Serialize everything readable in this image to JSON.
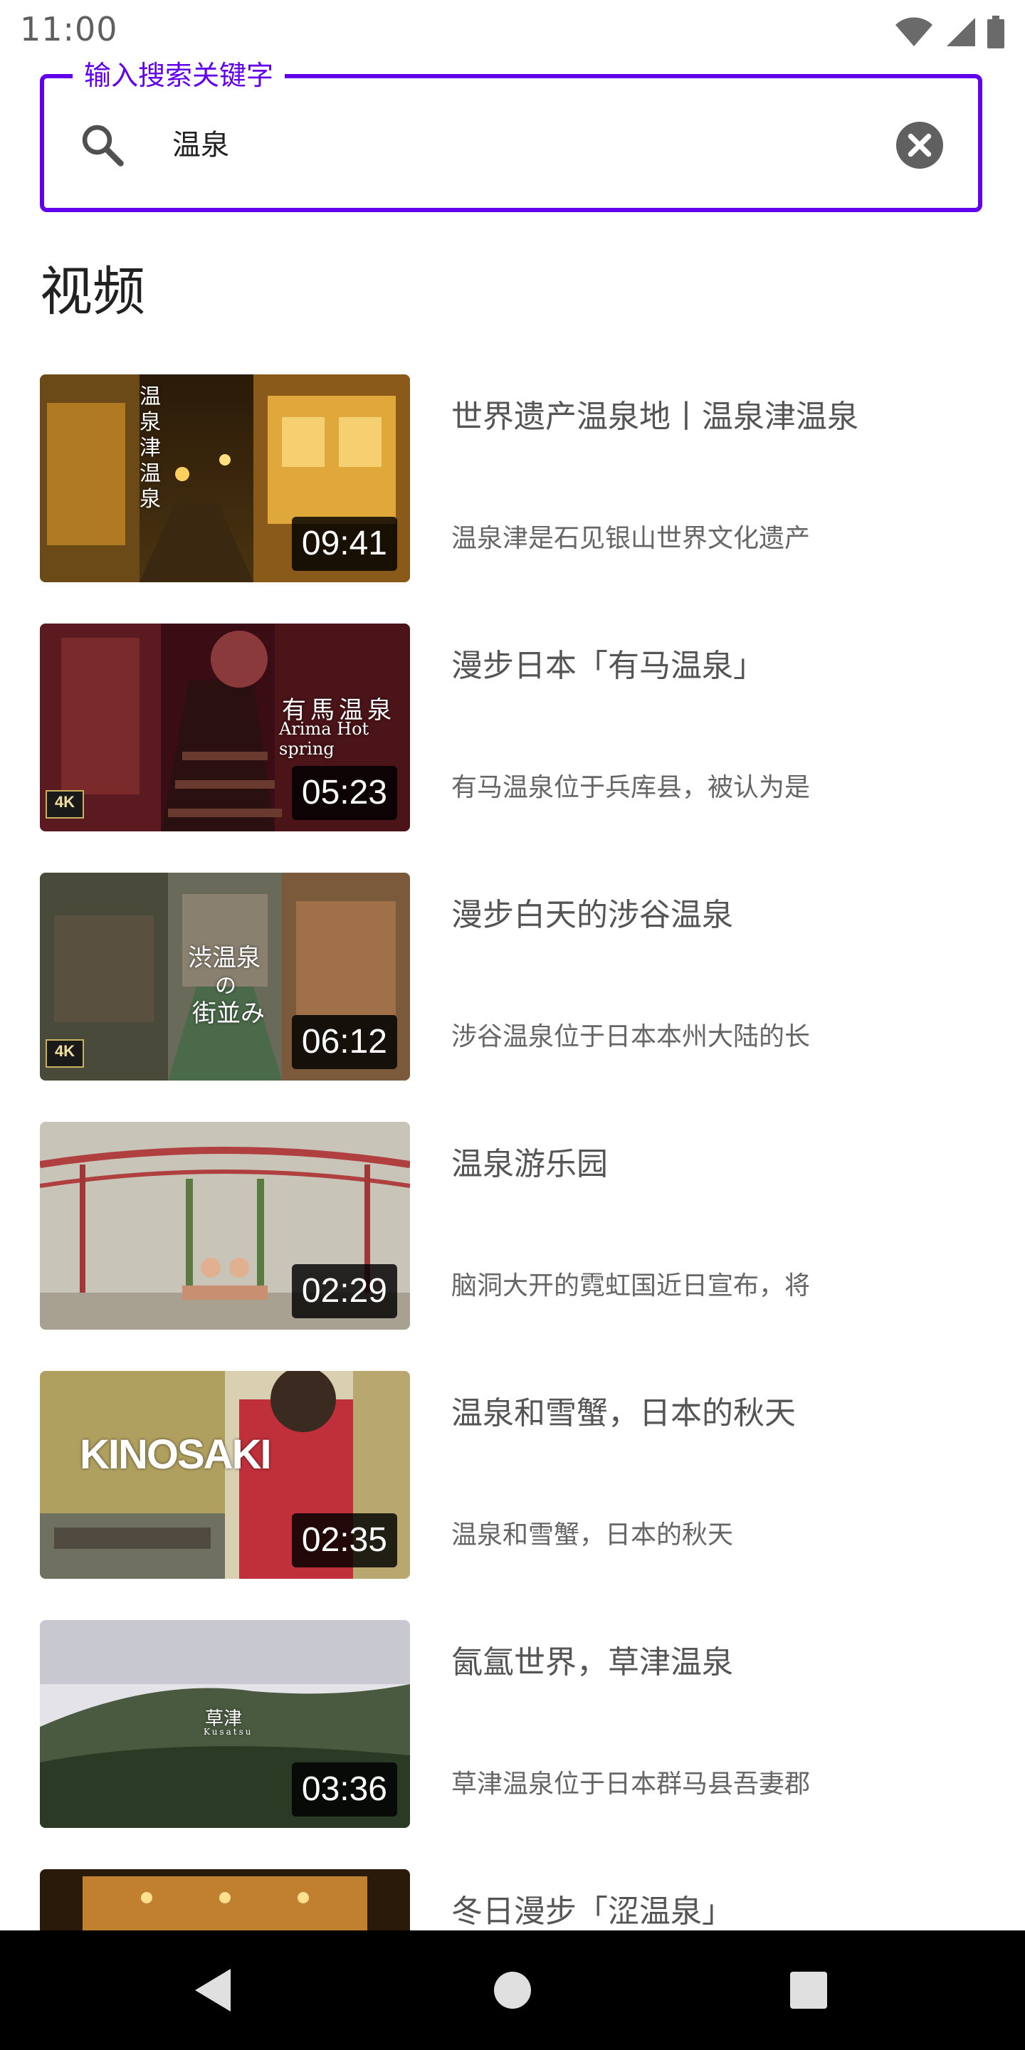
{
  "status_bar": {
    "time": "11:00",
    "icons": [
      "wifi-icon",
      "signal-icon",
      "battery-icon"
    ]
  },
  "search": {
    "label": "输入搜索关键字",
    "value": "温泉",
    "accent_color": "#6200ee"
  },
  "section": {
    "title": "视频"
  },
  "videos": [
    {
      "title": "世界遗产温泉地丨温泉津温泉",
      "description": "温泉津是石见银山世界文化遗产",
      "duration": "09:41",
      "badge": "",
      "thumb_caption": "温泉津温泉"
    },
    {
      "title": "漫步日本「有马温泉」",
      "description": "有马温泉位于兵库县，被认为是",
      "duration": "05:23",
      "badge": "4K",
      "thumb_caption": "有馬温泉",
      "thumb_subcaption": "Arima Hot spring"
    },
    {
      "title": "漫步白天的涉谷温泉",
      "description": "涉谷温泉位于日本本州大陆的长",
      "duration": "06:12",
      "badge": "4K",
      "thumb_caption": "渋温泉",
      "thumb_subcaption": "の",
      "thumb_subcaption2": "街並み"
    },
    {
      "title": "温泉游乐园",
      "description": "脑洞大开的霓虹国近日宣布，将",
      "duration": "02:29",
      "badge": ""
    },
    {
      "title": "温泉和雪蟹，日本的秋天",
      "description": "温泉和雪蟹，日本的秋天",
      "duration": "02:35",
      "badge": "",
      "thumb_caption": "KINOSAKI"
    },
    {
      "title": "氤氲世界，草津温泉",
      "description": "草津温泉位于日本群马县吾妻郡",
      "duration": "03:36",
      "badge": "",
      "thumb_caption": "草津",
      "thumb_subcaption": "Kusatsu"
    },
    {
      "title": "冬日漫步「涩温泉」",
      "description": "",
      "duration": "",
      "badge": ""
    }
  ],
  "nav_bar": {
    "buttons": [
      "back-icon",
      "home-icon",
      "recents-icon"
    ]
  }
}
